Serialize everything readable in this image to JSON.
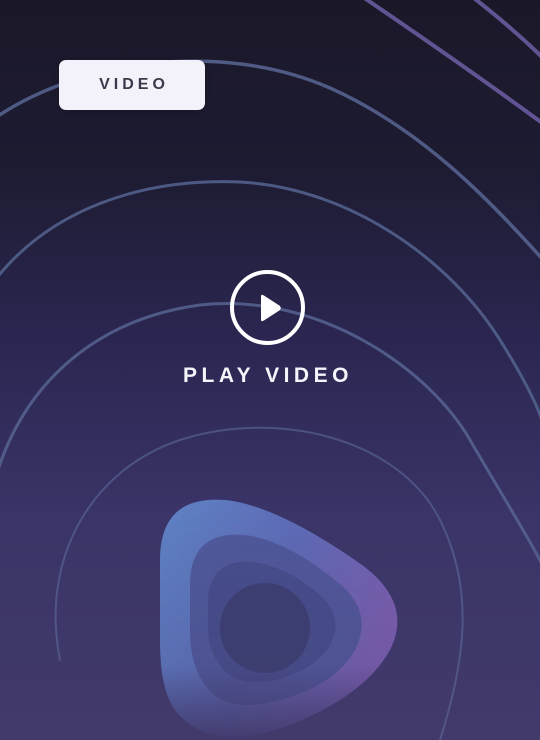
{
  "badge": {
    "label": "VIDEO"
  },
  "player": {
    "play_label": "PLAY VIDEO",
    "play_icon": "play-icon"
  },
  "decor": {
    "ring_pattern": "concentric-rounded-triangle-lines",
    "logo_mark": "stylized-play-triangle-logo"
  },
  "colors": {
    "background_top": "#1a1828",
    "background_bottom": "#423a6b",
    "ring_stroke": "#5b6a9a",
    "ring_stroke_accent": "#6c5b9e",
    "badge_background": "#f3f2fb",
    "badge_text": "#3a3a4a",
    "play_label": "#f4f4fa",
    "logo_blue": "#5f84c6",
    "logo_purple": "#7b5fb0"
  }
}
